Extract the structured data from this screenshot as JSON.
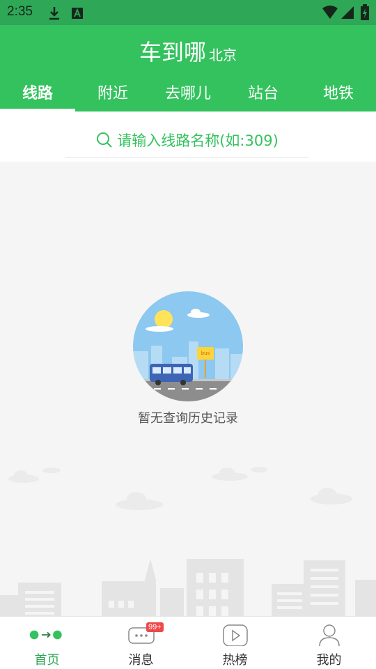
{
  "status_bar": {
    "time": "2:35"
  },
  "header": {
    "title": "车到哪",
    "city": "北京"
  },
  "tabs": [
    {
      "label": "线路",
      "active": true
    },
    {
      "label": "附近",
      "active": false
    },
    {
      "label": "去哪儿",
      "active": false
    },
    {
      "label": "站台",
      "active": false
    },
    {
      "label": "地铁",
      "active": false
    }
  ],
  "search": {
    "placeholder": "请输入线路名称(如:309)"
  },
  "empty_state": {
    "message": "暂无查询历史记录",
    "illustration_sign": "bus"
  },
  "bottom_nav": [
    {
      "label": "首页",
      "icon": "home-route-icon",
      "active": true
    },
    {
      "label": "消息",
      "icon": "message-icon",
      "badge": "99+"
    },
    {
      "label": "热榜",
      "icon": "play-icon"
    },
    {
      "label": "我的",
      "icon": "profile-icon"
    }
  ],
  "colors": {
    "primary": "#34c25e",
    "status_bar": "#2ea757",
    "badge": "#f04848"
  }
}
